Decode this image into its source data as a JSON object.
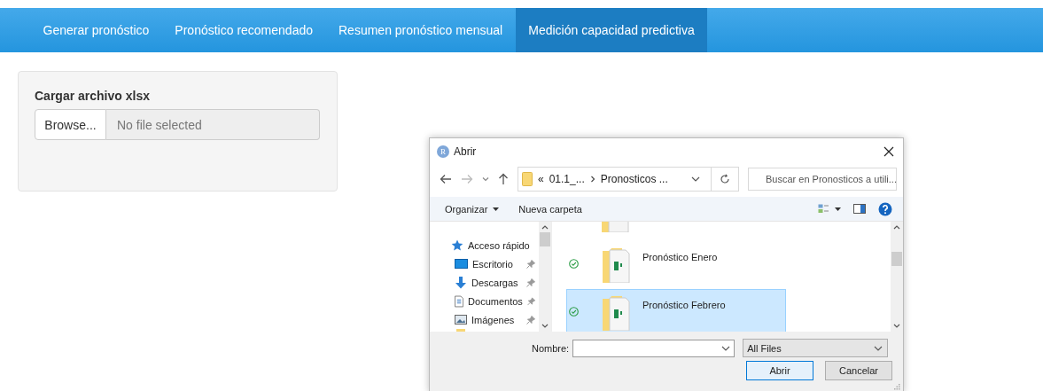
{
  "tabs": [
    {
      "label": "Generar pronóstico",
      "selected": false
    },
    {
      "label": "Pronóstico recomendado",
      "selected": false
    },
    {
      "label": "Resumen pronóstico mensual",
      "selected": false
    },
    {
      "label": "Medición capacidad predictiva",
      "selected": true
    }
  ],
  "upload": {
    "label": "Cargar archivo xlsx",
    "button": "Browse...",
    "placeholder": "No file selected"
  },
  "dialog": {
    "title": "Abrir",
    "app_badge": "R",
    "address": {
      "overflow": "«",
      "segments": [
        "01.1_...",
        "Pronosticos ..."
      ]
    },
    "search": {
      "placeholder": "Buscar en Pronosticos a utili..."
    },
    "toolbar": [
      "Organizar",
      "Nueva carpeta"
    ],
    "nav_items": [
      {
        "label": "Acceso rápido",
        "kind": "star",
        "pinned": false
      },
      {
        "label": "Escritorio",
        "kind": "desktop",
        "pinned": true
      },
      {
        "label": "Descargas",
        "kind": "download",
        "pinned": true
      },
      {
        "label": "Documentos",
        "kind": "document",
        "pinned": true
      },
      {
        "label": "Imágenes",
        "kind": "image",
        "pinned": true
      }
    ],
    "files": [
      {
        "name": "Pronóstico Enero",
        "selected": false
      },
      {
        "name": "Pronóstico Febrero",
        "selected": true
      }
    ],
    "filename_label": "Nombre:",
    "filetype": "All Files",
    "buttons": [
      {
        "label": "Abrir",
        "kind": "default"
      },
      {
        "label": "Cancelar",
        "kind": "normal"
      }
    ]
  }
}
